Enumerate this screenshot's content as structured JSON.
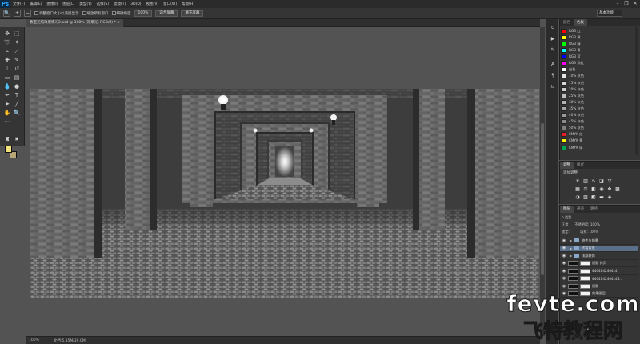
{
  "app": {
    "logo": "Ps",
    "menu": [
      "文件(F)",
      "编辑(E)",
      "图像(I)",
      "图层(L)",
      "类型(Y)",
      "选择(S)",
      "滤镜(T)",
      "3D(D)",
      "视图(V)",
      "窗口(W)",
      "帮助(H)"
    ],
    "window_controls": [
      "–",
      "❐",
      "✕"
    ]
  },
  "options_bar": {
    "tool_icon": "zoom-icon",
    "check1_label": "调整窗口大小以满屏显示",
    "check2_label": "缩放所有窗口",
    "check3_label": "细微缩放",
    "btn_100": "100%",
    "btn_fit": "适合屏幕",
    "btn_fill": "填充屏幕",
    "workspace": "基本功能"
  },
  "document": {
    "tab_title": "教室光照效果练习2.psd @ 100% (效果光, RGB/8) * ×",
    "close_glyph": "×"
  },
  "status": {
    "zoom": "100%",
    "doc_size": "文档:5.85M/39.0M"
  },
  "swatches": {
    "tabs": [
      "颜色",
      "色板"
    ],
    "active_tab": 1,
    "items": [
      {
        "name": "RGB 红",
        "color": "#ff0000"
      },
      {
        "name": "RGB 黄",
        "color": "#ffff00"
      },
      {
        "name": "RGB 绿",
        "color": "#00ff00"
      },
      {
        "name": "RGB 青",
        "color": "#00ffff"
      },
      {
        "name": "RGB 蓝",
        "color": "#0000ff"
      },
      {
        "name": "RGB 洋红",
        "color": "#ff00ff"
      },
      {
        "name": "白色",
        "color": "#ffffff"
      },
      {
        "name": "10% 灰色",
        "color": "#e6e6e6"
      },
      {
        "name": "15% 灰色",
        "color": "#d9d9d9"
      },
      {
        "name": "20% 灰色",
        "color": "#cccccc"
      },
      {
        "name": "25% 灰色",
        "color": "#bfbfbf"
      },
      {
        "name": "30% 灰色",
        "color": "#b3b3b3"
      },
      {
        "name": "35% 灰色",
        "color": "#a6a6a6"
      },
      {
        "name": "40% 灰色",
        "color": "#999999"
      },
      {
        "name": "45% 灰色",
        "color": "#8c8c8c"
      },
      {
        "name": "50% 灰色",
        "color": "#808080"
      },
      {
        "name": "CMYK 红",
        "color": "#ed1c24"
      },
      {
        "name": "CMYK 黄",
        "color": "#fff200"
      },
      {
        "name": "CMYK 绿",
        "color": "#00a651"
      }
    ]
  },
  "adjustments": {
    "tabs": [
      "调整",
      "样式"
    ],
    "title": "添加调整"
  },
  "layers": {
    "tabs": [
      "图层",
      "通道",
      "路径"
    ],
    "filter_label": "ρ 类型",
    "blend_mode": "正常",
    "opacity_label": "不透明度: 100%",
    "lock_label": "锁定:",
    "fill_label": "填充: 100%",
    "rows": [
      {
        "name": "物件与前景",
        "type": "group",
        "selected": false
      },
      {
        "name": "砖墙背景",
        "type": "group",
        "selected": true
      },
      {
        "name": "顶部装饰",
        "type": "group",
        "selected": false
      },
      {
        "name": "阴影 拷贝",
        "type": "layer",
        "selected": false
      },
      {
        "name": "4404042404c4",
        "type": "layer",
        "selected": false
      },
      {
        "name": "4404042404c4S...",
        "type": "layer",
        "selected": false
      },
      {
        "name": "阴影",
        "type": "layer",
        "selected": false
      },
      {
        "name": "效果图层",
        "type": "layer",
        "selected": false
      }
    ]
  },
  "watermark": {
    "top": "fevte.com",
    "bottom": "飞特教程网"
  }
}
